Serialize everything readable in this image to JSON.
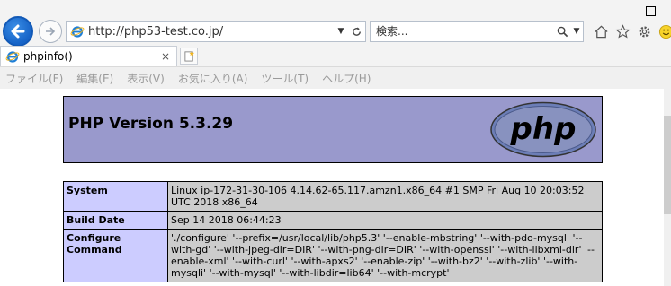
{
  "browser": {
    "address_url": "http://php53-test.co.jp/",
    "search_placeholder": "検索...",
    "tab_title": "phpinfo()",
    "tab_close": "×",
    "menu": [
      "ファイル(F)",
      "編集(E)",
      "表示(V)",
      "お気に入り(A)",
      "ツール(T)",
      "ヘルプ(H)"
    ],
    "toolbar_icons": [
      "home-icon",
      "star-icon",
      "gear-icon",
      "smiley-icon"
    ]
  },
  "php": {
    "version_title": "PHP Version 5.3.29",
    "logo_text": "php",
    "rows": [
      {
        "key": "System",
        "value": "Linux ip-172-31-30-106 4.14.62-65.117.amzn1.x86_64 #1 SMP Fri Aug 10 20:03:52 UTC 2018 x86_64"
      },
      {
        "key": "Build Date",
        "value": "Sep 14 2018 06:44:23"
      },
      {
        "key": "Configure Command",
        "value": "'./configure' '--prefix=/usr/local/lib/php5.3' '--enable-mbstring' '--with-pdo-mysql' '--with-gd' '--with-jpeg-dir=DIR' '--with-png-dir=DIR' '--with-openssl' '--with-libxml-dir' '--enable-xml' '--with-curl' '--with-apxs2' '--enable-zip' '--with-bz2' '--with-zlib' '--with-mysqli' '--with-mysql' '--with-libdir=lib64' '--with-mcrypt'"
      }
    ]
  },
  "colors": {
    "header_bg": "#9999cc",
    "key_bg": "#ccccff",
    "value_bg": "#cccccc",
    "back_button": "#1663c7"
  }
}
